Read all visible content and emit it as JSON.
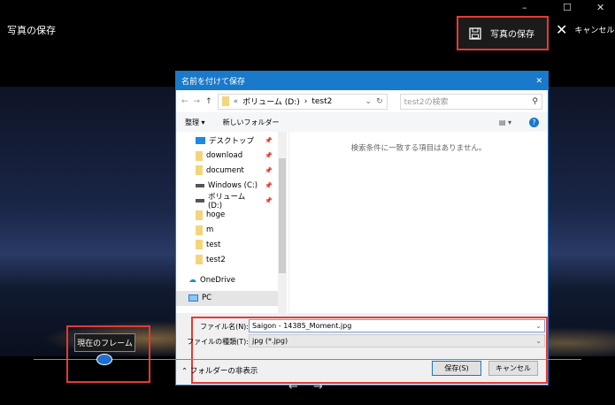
{
  "app": {
    "title": "写真の保存",
    "save_label": "写真の保存",
    "cancel_label": "キャンセル",
    "window_controls": [
      "–",
      "☐",
      "✕"
    ]
  },
  "dialog": {
    "title": "名前を付けて保存",
    "close": "✕",
    "address": {
      "prefix": "«",
      "path": [
        "ボリューム (D:)",
        "test2"
      ],
      "separator": "›"
    },
    "search_placeholder": "test2の検索",
    "toolbar": {
      "organize": "整理 ▾",
      "new_folder": "新しいフォルダー"
    },
    "nav_items": [
      {
        "label": "デスクトップ",
        "icon": "desktop-icon",
        "pinned": true
      },
      {
        "label": "download",
        "icon": "folder-icon",
        "pinned": true
      },
      {
        "label": "document",
        "icon": "folder-icon",
        "pinned": true
      },
      {
        "label": "Windows (C:)",
        "icon": "drive-icon",
        "pinned": true
      },
      {
        "label": "ボリューム (D:)",
        "icon": "drive-icon",
        "pinned": true
      },
      {
        "label": "hoge",
        "icon": "folder-icon",
        "pinned": false
      },
      {
        "label": "m",
        "icon": "folder-icon",
        "pinned": false
      },
      {
        "label": "test",
        "icon": "folder-icon",
        "pinned": false
      },
      {
        "label": "test2",
        "icon": "folder-icon",
        "pinned": false
      },
      {
        "label": "OneDrive",
        "icon": "cloud-icon",
        "pinned": false
      },
      {
        "label": "PC",
        "icon": "pc-icon",
        "pinned": false
      }
    ],
    "empty_message": "検索条件に一致する項目はありません。",
    "filename_label": "ファイル名(N):",
    "filename": "Saigon - 14385_Moment.jpg",
    "filetype_label": "ファイルの種類(T):",
    "filetype": "jpg (*.jpg)",
    "hide_folders": "フォルダーの非表示",
    "save": "保存(S)",
    "cancel": "キャンセル"
  },
  "frame": {
    "current_frame_label": "現在のフレーム",
    "position_fraction": 0.13
  },
  "accent": "#1979ca",
  "highlight": "#e53935"
}
